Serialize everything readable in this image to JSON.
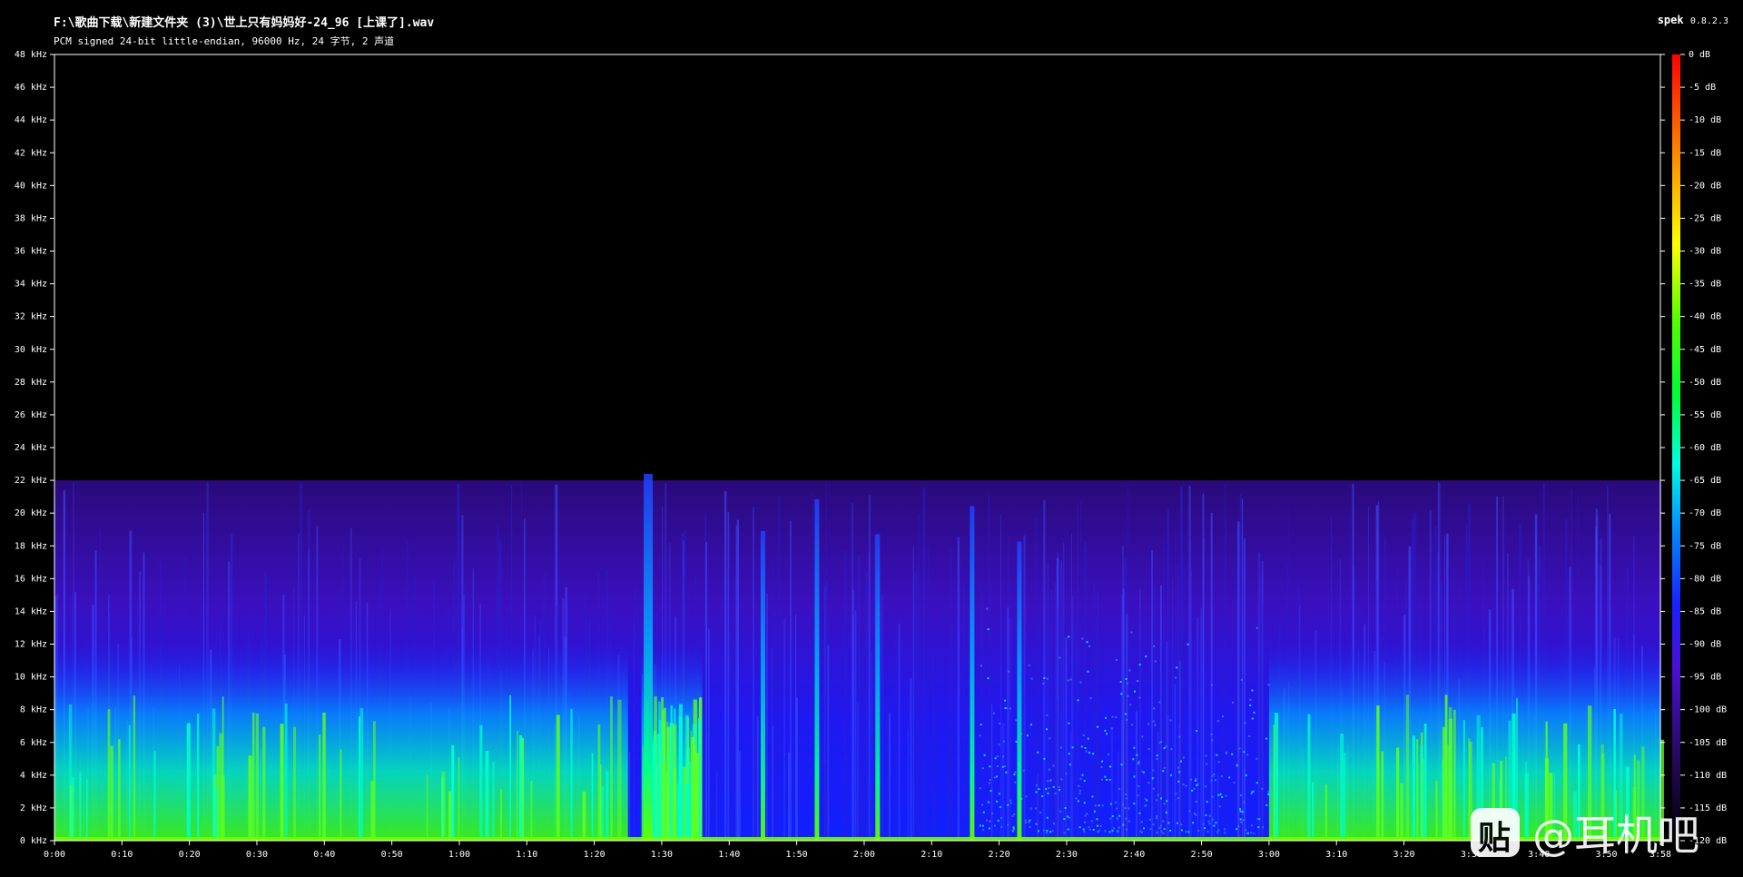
{
  "header": {
    "title": "F:\\歌曲下载\\新建文件夹 (3)\\世上只有妈妈好-24_96 [上课了].wav",
    "subtitle": "PCM signed 24-bit little-endian, 96000 Hz, 24 字节, 2 声道",
    "app_name": "spek",
    "app_version": "0.8.2.3"
  },
  "watermark": {
    "text": "@耳机吧",
    "icon": "tieba-logo-icon"
  },
  "chart_data": {
    "type": "heatmap",
    "title": "",
    "xlabel": "",
    "ylabel": "",
    "x_ticks": [
      "0:00",
      "0:10",
      "0:20",
      "0:30",
      "0:40",
      "0:50",
      "1:00",
      "1:10",
      "1:20",
      "1:30",
      "1:40",
      "1:50",
      "2:00",
      "2:10",
      "2:20",
      "2:30",
      "2:40",
      "2:50",
      "3:00",
      "3:10",
      "3:20",
      "3:30",
      "3:40",
      "3:50",
      "3:58"
    ],
    "xlim_seconds": [
      0,
      238
    ],
    "y_ticks": [
      "0 kHz",
      "2 kHz",
      "4 kHz",
      "6 kHz",
      "8 kHz",
      "10 kHz",
      "12 kHz",
      "14 kHz",
      "16 kHz",
      "18 kHz",
      "20 kHz",
      "22 kHz",
      "24 kHz",
      "26 kHz",
      "28 kHz",
      "30 kHz",
      "32 kHz",
      "34 kHz",
      "36 kHz",
      "38 kHz",
      "40 kHz",
      "42 kHz",
      "44 kHz",
      "46 kHz",
      "48 kHz"
    ],
    "ylim_khz": [
      0,
      48
    ],
    "colorbar_ticks": [
      "0 dB",
      "-5 dB",
      "-10 dB",
      "-15 dB",
      "-20 dB",
      "-25 dB",
      "-30 dB",
      "-35 dB",
      "-40 dB",
      "-45 dB",
      "-50 dB",
      "-55 dB",
      "-60 dB",
      "-65 dB",
      "-70 dB",
      "-75 dB",
      "-80 dB",
      "-85 dB",
      "-90 dB",
      "-95 dB",
      "-100 dB",
      "-105 dB",
      "-110 dB",
      "-115 dB",
      "-120 dB"
    ],
    "colorbar_range_db": [
      -120,
      0
    ],
    "content_cutoff_khz": 22,
    "loud_sections_seconds": [
      [
        0,
        85
      ],
      [
        87,
        96
      ],
      [
        180,
        238
      ]
    ],
    "transient_peaks_seconds": [
      88,
      105,
      113,
      122,
      136,
      143
    ],
    "colors": {
      "background": "#000000",
      "axis": "#ffffff",
      "floor": "#2a0a6a",
      "high": "#ff0000"
    }
  }
}
